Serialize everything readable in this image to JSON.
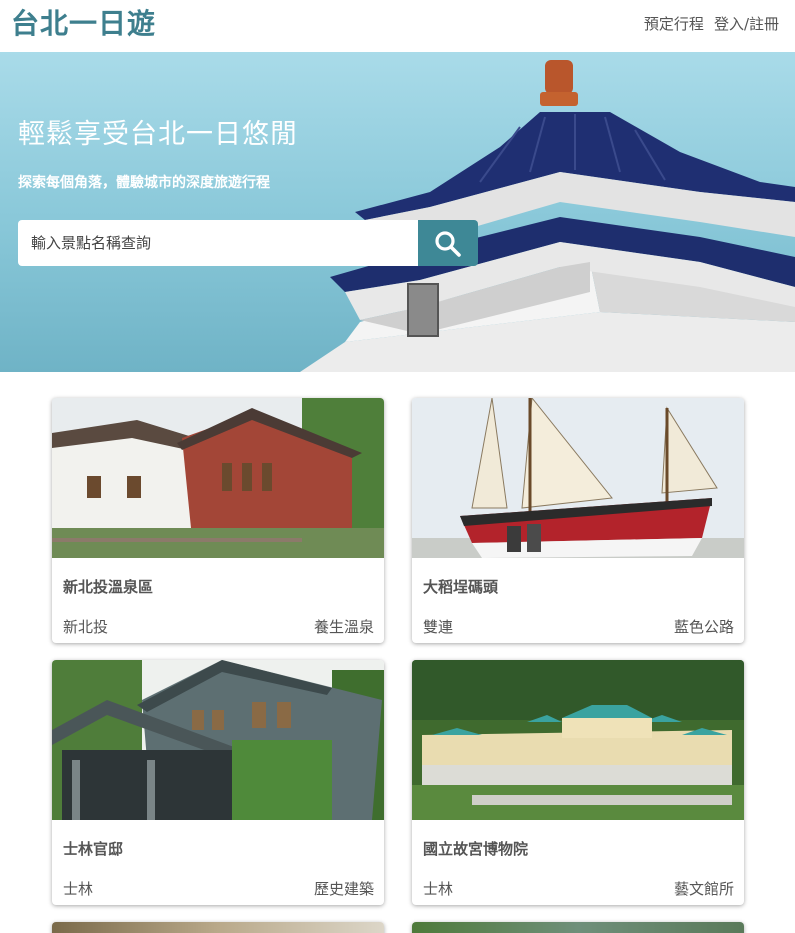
{
  "navbar": {
    "logo": "台北一日遊",
    "links": [
      "預定行程",
      "登入/註冊"
    ]
  },
  "hero": {
    "title": "輕鬆享受台北一日悠閒",
    "subtitle": "探索每個角落，體驗城市的深度旅遊行程",
    "search_placeholder": "輸入景點名稱查詢"
  },
  "attractions": [
    {
      "name": "新北投溫泉區",
      "area": "新北投",
      "category": "養生溫泉"
    },
    {
      "name": "大稻埕碼頭",
      "area": "雙連",
      "category": "藍色公路"
    },
    {
      "name": "士林官邸",
      "area": "士林",
      "category": "歷史建築"
    },
    {
      "name": "國立故宮博物院",
      "area": "士林",
      "category": "藝文館所"
    }
  ],
  "colors": {
    "brand": "#3e7f8e",
    "search_button": "#3e8896"
  }
}
